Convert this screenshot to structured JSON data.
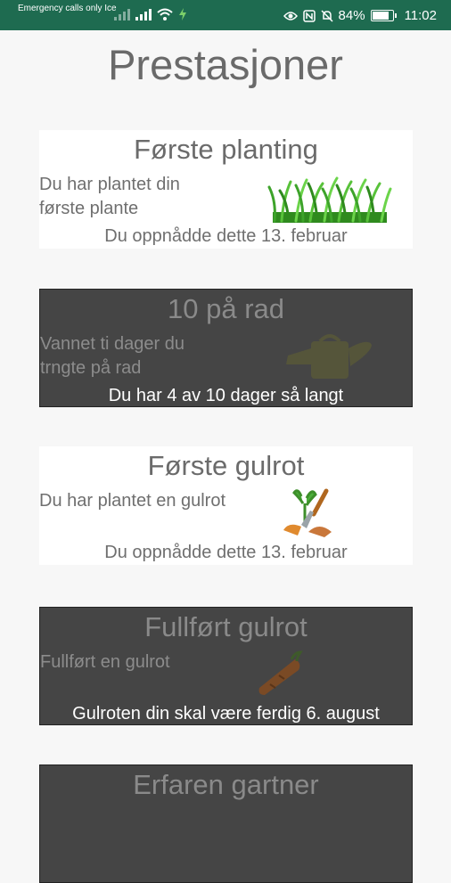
{
  "status_bar": {
    "carrier": "Emergency calls only Ice",
    "battery": "84%",
    "time": "11:02"
  },
  "page": {
    "title": "Prestasjoner"
  },
  "achievements": [
    {
      "title": "Første planting",
      "description": "Du har plantet din første plante",
      "status": "Du oppnådde dette 13. februar",
      "icon": "grass-icon",
      "unlocked": true
    },
    {
      "title": "10 på rad",
      "description": "Vannet ti dager du trngte på rad",
      "status": "Du har 4 av 10 dager så langt",
      "icon": "watering-can-icon",
      "unlocked": false
    },
    {
      "title": "Første gulrot",
      "description": "Du har plantet en gulrot",
      "status": "Du oppnådde dette 13. februar",
      "icon": "trowel-carrot-icon",
      "unlocked": true
    },
    {
      "title": "Fullført gulrot",
      "description": "Fullført en gulrot",
      "status": "Gulroten din skal være ferdig 6. august",
      "icon": "carrot-icon",
      "unlocked": false
    },
    {
      "title": "Erfaren gartner",
      "unlocked": false
    }
  ]
}
